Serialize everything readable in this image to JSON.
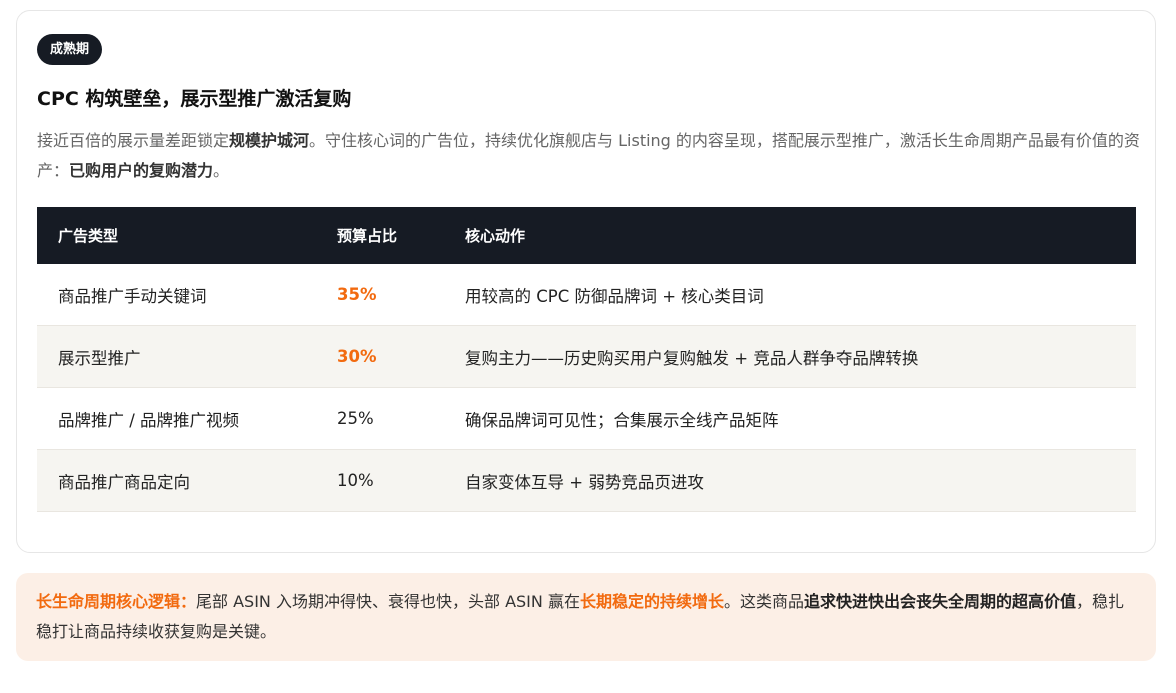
{
  "badge": "成熟期",
  "title": "CPC 构筑壁垒，展示型推广激活复购",
  "description": {
    "p1": "接近百倍的展示量差距锁定",
    "b1": "规模护城河",
    "p2": "。守住核心词的广告位，持续优化旗舰店与 Listing 的内容呈现，搭配展示型推广，激活长生命周期产品最有价值的资产：",
    "b2": "已购用户的复购潜力",
    "p3": "。"
  },
  "table": {
    "headers": [
      "广告类型",
      "预算占比",
      "核心动作"
    ],
    "rows": [
      {
        "type": "商品推广手动关键词",
        "budget": "35%",
        "action": "用较高的 CPC 防御品牌词 + 核心类目词"
      },
      {
        "type": "展示型推广",
        "budget": "30%",
        "action": "复购主力——历史购买用户复购触发 + 竞品人群争夺品牌转换"
      },
      {
        "type": "品牌推广 / 品牌推广视频",
        "budget": "25%",
        "action": "确保品牌词可见性；合集展示全线产品矩阵"
      },
      {
        "type": "商品推广商品定向",
        "budget": "10%",
        "action": "自家变体互导 + 弱势竞品页进攻"
      }
    ]
  },
  "note": {
    "label": "长生命周期核心逻辑：",
    "t1": "尾部 ASIN 入场期冲得快、衰得也快，头部 ASIN 赢在",
    "h1": "长期稳定的持续增长",
    "t2": "。这类商品",
    "b1": "追求快进快出会丧失全周期的超高价值",
    "t3": "，稳扎稳打让商品持续收获复购是关键。"
  },
  "colors": {
    "accent": "#f26a0f",
    "dark": "#161b24",
    "note_bg": "#fcefe6",
    "alt_row": "#f6f5f1"
  }
}
